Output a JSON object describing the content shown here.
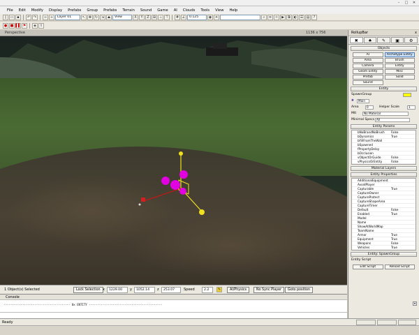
{
  "menu": [
    "File",
    "Edit",
    "Modify",
    "Display",
    "Prefabs",
    "Group",
    "Prefabs",
    "Terrain",
    "Sound",
    "Game",
    "AI",
    "Clouds",
    "Tools",
    "View",
    "Help"
  ],
  "toolbar": {
    "layer_value": "Layer 01",
    "view_value": "View",
    "scale_value": "0.125"
  },
  "viewport": {
    "label": "Perspective",
    "resolution": "1136 x 756"
  },
  "status": {
    "selection_text": "1 Object(s) Selected",
    "lock_selection": "Lock Selection",
    "x_label": "x",
    "x_value": "1229.00",
    "y_label": "y",
    "y_value": "1052.14",
    "z_label": "z",
    "z_value": "253.07",
    "speed_label": "Speed",
    "speed_value": "2.2",
    "ai_physics": "AI/Physics",
    "no_sync_player": "No Sync Player",
    "goto_position": "Goto position"
  },
  "console": {
    "title": "Console",
    "line": "--------------------------------------- 0x ENTITY -------------------------------------------"
  },
  "statusbar": {
    "ready": "Ready"
  },
  "panel": {
    "title": "RollupBar",
    "close": "x",
    "tabs": [
      "✖",
      "♠",
      "✎",
      "▣",
      "⚙"
    ],
    "objects_head": "Objects",
    "objects": [
      "AI",
      "Archetype Entity",
      "Area",
      "Brush",
      "Camera",
      "Entity",
      "Geom Entity",
      "Misc",
      "Prefab",
      "Solid",
      "Sound",
      ""
    ],
    "entity_head": "Entity",
    "entity_class": "SpawnGroup",
    "mtl_label": "Mtl",
    "mtl_value": "No Material",
    "area_label": "Area",
    "area_value": "0",
    "helper_label": "Helper Scale",
    "helper_value": "1",
    "minspec_label": "Minimal Specs",
    "minspec_value": "All",
    "params_head": "Entity Params",
    "params": [
      {
        "name": "bNoBrandNoBrush",
        "val": "False"
      },
      {
        "name": "bDynamics",
        "val": "True"
      },
      {
        "name": "bFillFromTheWall",
        "val": ""
      },
      {
        "name": "bSpawned",
        "val": ""
      },
      {
        "name": "fPropertyDelay",
        "val": ""
      },
      {
        "name": "bOcclusion",
        "val": ""
      },
      {
        "name": "vObjectOrGuide",
        "val": "False"
      },
      {
        "name": "vPhysicsOrEntity",
        "val": "False"
      }
    ],
    "material_head": "Material Layers",
    "props_head": "Entity Properties",
    "props": [
      {
        "name": "AdditionalEquipment",
        "val": ""
      },
      {
        "name": "AvoidPlayer",
        "val": ""
      },
      {
        "name": "Capturable",
        "val": "True"
      },
      {
        "name": "CaptureOwner",
        "val": ""
      },
      {
        "name": "CaptureProtect",
        "val": ""
      },
      {
        "name": "CaptureShapeArea",
        "val": ""
      },
      {
        "name": "CaptureTimer",
        "val": ""
      },
      {
        "name": "Default",
        "val": "False"
      },
      {
        "name": "Enabled",
        "val": "True"
      },
      {
        "name": "Model",
        "val": ""
      },
      {
        "name": "Name",
        "val": ""
      },
      {
        "name": "ShowAtWorldMap",
        "val": ""
      },
      {
        "name": "TeamName",
        "val": ""
      }
    ],
    "props2": [
      {
        "name": "Armor",
        "val": "True"
      },
      {
        "name": "Equipment",
        "val": "True"
      },
      {
        "name": "Weapons",
        "val": "False"
      },
      {
        "name": "Vehicles",
        "val": "True"
      }
    ],
    "spawngroup_head": "Entity: SpawnGroup",
    "entity_script": "Entity Script",
    "bottom_buttons": [
      "Edit Script",
      "Reload Script"
    ]
  },
  "colors": {
    "selection_gizmo": "#e000e0",
    "axis_y": "#f0e020",
    "axis_x": "#e02020"
  }
}
